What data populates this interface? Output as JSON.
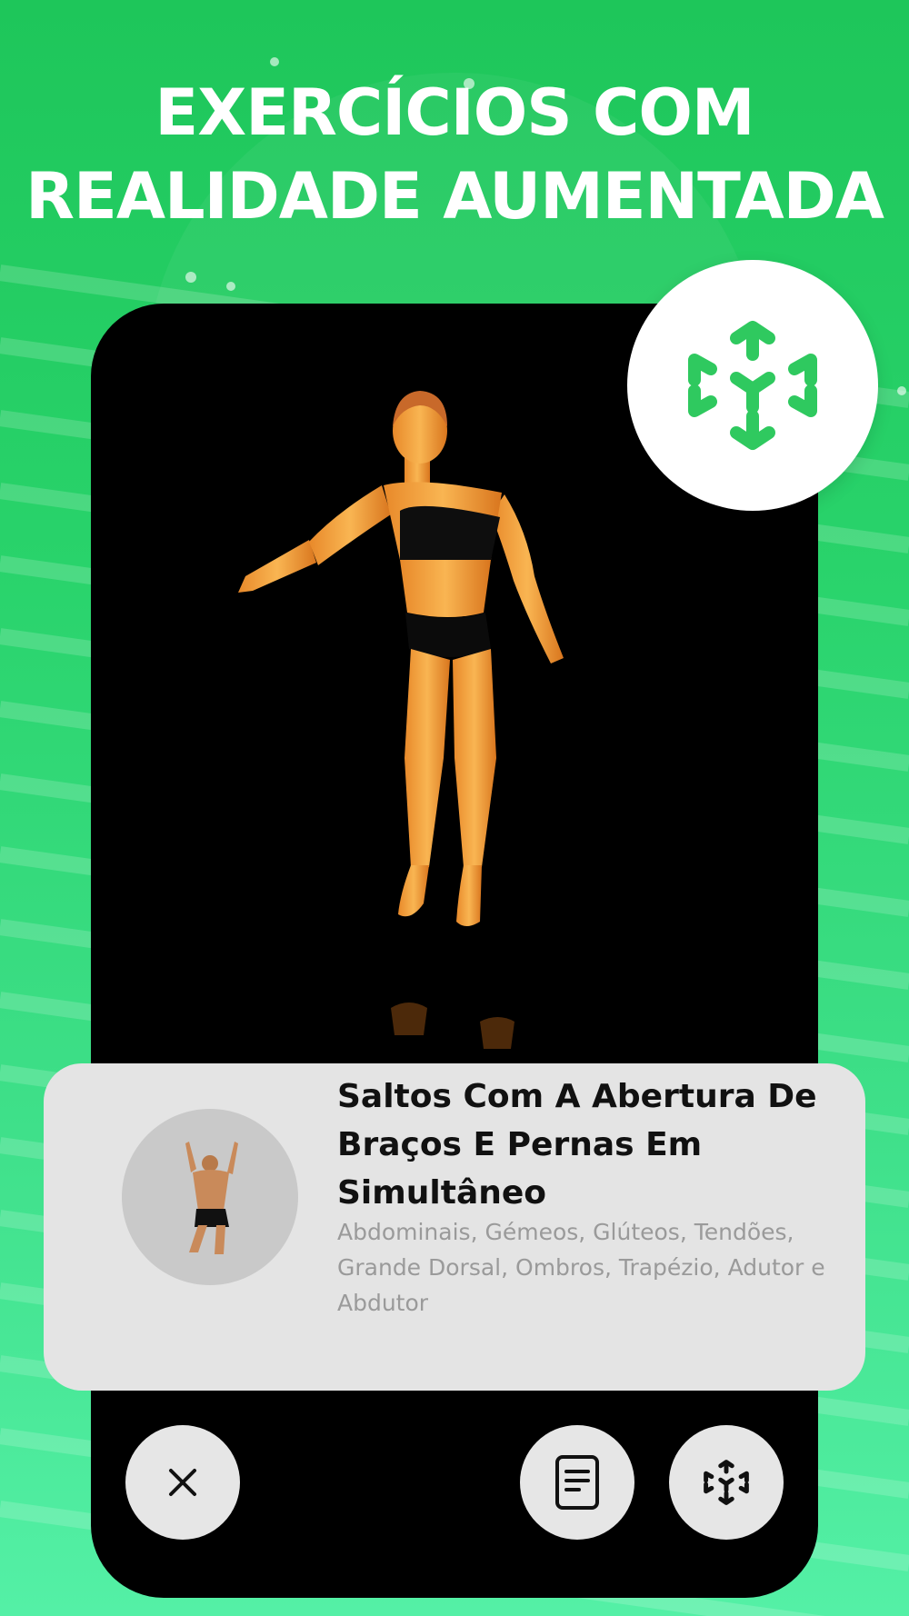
{
  "headline": {
    "line1": "EXERCÍCIOS COM",
    "line2": "REALIDADE AUMENTADA"
  },
  "icons": {
    "ar_badge": "ar-cube-icon",
    "close": "close-icon",
    "instructions": "document-icon",
    "ar_view": "ar-cube-icon"
  },
  "exercise": {
    "title": "Saltos Com A Abertura De Braços E Pernas Em Simultâneo",
    "muscles": "Abdominais, Gémeos, Glúteos, Tendões, Grande Dorsal, Ombros, Trapézio, Adutor e Abdutor"
  },
  "colors": {
    "brand_green": "#2fc95f",
    "background_top": "#1ec65a",
    "background_bottom": "#54f0a6",
    "card": "#e4e4e4"
  }
}
